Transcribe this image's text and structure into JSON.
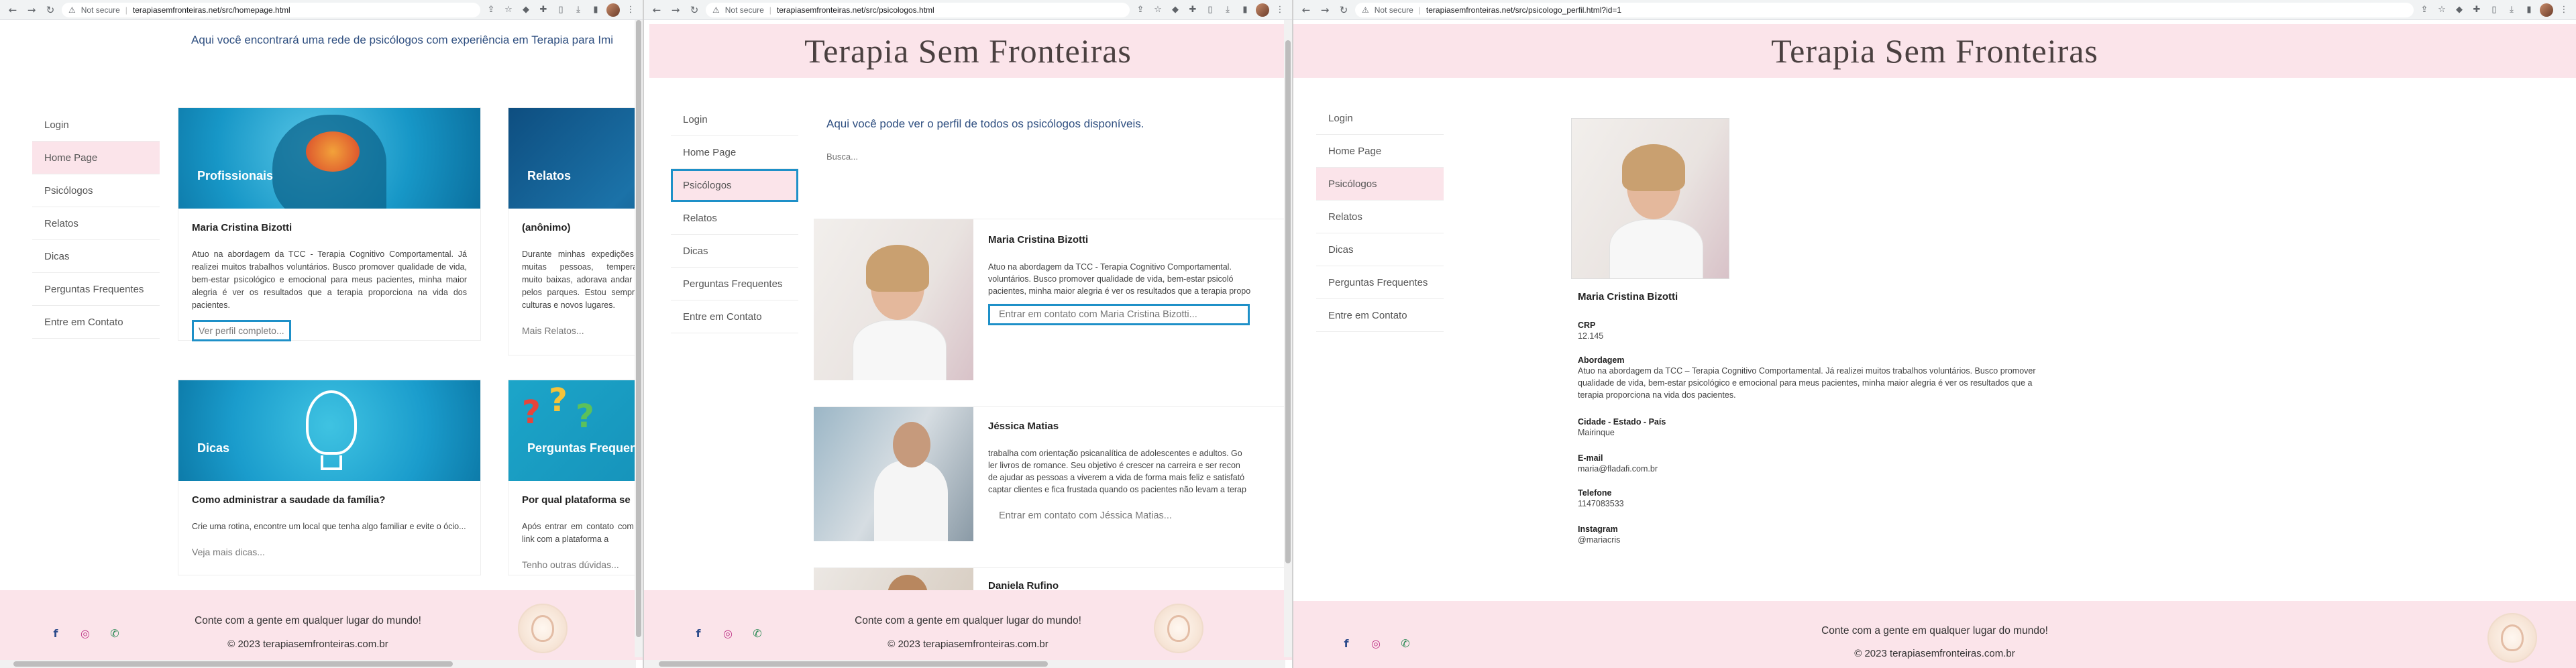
{
  "windows": [
    {
      "chrome": {
        "security": "Not secure",
        "url": "terapiasemfronteiras.net/src/homepage.html"
      },
      "subtitle": "Aqui você encontrará uma rede de psicólogos com experiência em Terapia para Imi",
      "sidebar": [
        "Login",
        "Home Page",
        "Psicólogos",
        "Relatos",
        "Dicas",
        "Perguntas Frequentes",
        "Entre em Contato"
      ],
      "cards": [
        {
          "img_label": "Profissionais",
          "title": "Maria Cristina Bizotti",
          "text": "Atuo na abordagem da TCC - Terapia Cognitivo Comportamental. Já realizei muitos trabalhos voluntários. Busco promover qualidade de vida, bem-estar psicológico e emocional para meus pacientes, minha maior alegria é ver os resultados que a terapia proporciona na vida dos pacientes.",
          "link": "Ver perfil completo..."
        },
        {
          "img_label": "Relatos",
          "title": "(anônimo)",
          "text": "Durante minhas expedições com muitas pessoas, temperaturas muito baixas, adorava andar à toa pelos parques. Estou sempre em culturas e novos lugares.",
          "link": "Mais Relatos..."
        },
        {
          "img_label": "Dicas",
          "title": "Como administrar a saudade da família?",
          "text": "Crie uma rotina, encontre um local que tenha algo familiar e evite o ócio...",
          "link": "Veja mais dicas..."
        },
        {
          "img_label": "Perguntas Frequentes",
          "title": "Por qual plataforma se",
          "text": "Após entrar em contato com um link com a plataforma a",
          "link": "Tenho outras dúvidas..."
        }
      ],
      "footer": {
        "text": "Conte com a gente em qualquer lugar do mundo!",
        "copyright": "© 2023 terapiasemfronteiras.com.br"
      }
    },
    {
      "chrome": {
        "security": "Not secure",
        "url": "terapiasemfronteiras.net/src/psicologos.html"
      },
      "site_title": "Terapia Sem Fronteiras",
      "sidebar": [
        "Login",
        "Home Page",
        "Psicólogos",
        "Relatos",
        "Dicas",
        "Perguntas Frequentes",
        "Entre em Contato"
      ],
      "intro": "Aqui você pode ver o perfil de todos os psicólogos disponíveis.",
      "search_placeholder": "Busca...",
      "psicologos": [
        {
          "name": "Maria Cristina Bizotti",
          "lines": [
            "Atuo na abordagem da TCC - Terapia Cognitivo Comportamental.",
            "voluntários. Busco promover qualidade de vida, bem-estar psicoló",
            "pacientes, minha maior alegria é ver os resultados que a terapia propo"
          ],
          "contact": "Entrar em contato com Maria Cristina Bizotti..."
        },
        {
          "name": "Jéssica Matias",
          "lines": [
            "trabalha com orientação psicanalítica de adolescentes e adultos. Go",
            "ler livros de romance. Seu objetivo é crescer na carreira e ser recon",
            "de ajudar as pessoas a viverem a vida de forma mais feliz e satisfató",
            "captar clientes e fica frustada quando os pacientes não levam a terap"
          ],
          "contact": "Entrar em contato com Jéssica Matias..."
        },
        {
          "name": "Daniela Rufino",
          "lines": [],
          "contact": ""
        }
      ],
      "footer": {
        "text": "Conte com a gente em qualquer lugar do mundo!",
        "copyright": "© 2023 terapiasemfronteiras.com.br"
      }
    },
    {
      "chrome": {
        "security": "Not secure",
        "url": "terapiasemfronteiras.net/src/psicologo_perfil.html?id=1"
      },
      "site_title": "Terapia Sem Fronteiras",
      "sidebar": [
        "Login",
        "Home Page",
        "Psicólogos",
        "Relatos",
        "Dicas",
        "Perguntas Frequentes",
        "Entre em Contato"
      ],
      "profile": {
        "name": "Maria Cristina Bizotti",
        "crp_label": "CRP",
        "crp": "12.145",
        "abordagem_label": "Abordagem",
        "abordagem_lines": [
          "Atuo na abordagem da TCC – Terapia Cognitivo Comportamental. Já realizei muitos trabalhos voluntários. Busco promover",
          "qualidade de vida, bem-estar psicológico e emocional para meus pacientes, minha maior alegria é ver os resultados que a",
          "terapia proporciona na vida dos pacientes."
        ],
        "cidade_label": "Cidade - Estado - País",
        "cidade": "Mairinque",
        "email_label": "E-mail",
        "email": "maria@fladafi.com.br",
        "telefone_label": "Telefone",
        "telefone": "1147083533",
        "instagram_label": "Instagram",
        "instagram": "@mariacris"
      },
      "footer": {
        "text": "Conte com a gente em qualquer lugar do mundo!",
        "copyright": "© 2023 terapiasemfronteiras.com.br"
      }
    }
  ],
  "colors": {
    "header_pink": "#fbe4ea",
    "focus_blue": "#1e90c8",
    "intro_blue": "#2f4f80"
  },
  "icons": {
    "back": "arrow-left-icon",
    "forward": "arrow-right-icon",
    "reload": "reload-icon",
    "warning": "warning-icon",
    "facebook": "facebook-icon",
    "instagram": "instagram-icon",
    "whatsapp": "whatsapp-icon"
  }
}
